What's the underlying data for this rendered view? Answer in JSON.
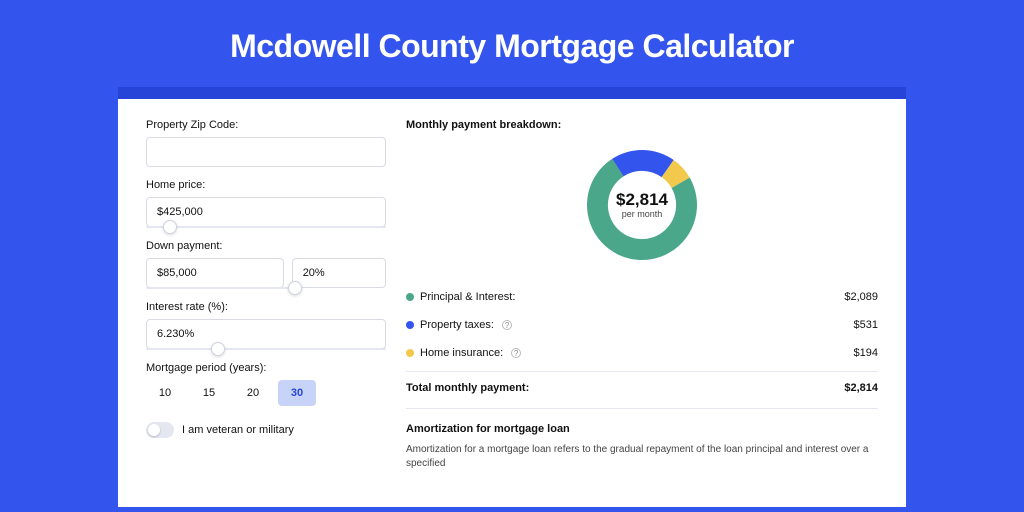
{
  "title": "Mcdowell County Mortgage Calculator",
  "form": {
    "zip_label": "Property Zip Code:",
    "zip_value": "",
    "home_price_label": "Home price:",
    "home_price_value": "$425,000",
    "home_price_slider_pct": 10,
    "down_payment_label": "Down payment:",
    "down_payment_value": "$85,000",
    "down_payment_pct": "20%",
    "down_payment_slider_pct": 20,
    "interest_label": "Interest rate (%):",
    "interest_value": "6.230%",
    "interest_slider_pct": 30,
    "period_label": "Mortgage period (years):",
    "periods": [
      "10",
      "15",
      "20",
      "30"
    ],
    "period_selected_index": 3,
    "veteran_label": "I am veteran or military"
  },
  "breakdown": {
    "title": "Monthly payment breakdown:",
    "center_value": "$2,814",
    "center_sub": "per month",
    "items": [
      {
        "label": "Principal & Interest:",
        "value": "$2,089",
        "color": "#4aa789",
        "has_info": false
      },
      {
        "label": "Property taxes:",
        "value": "$531",
        "color": "#3355ee",
        "has_info": true
      },
      {
        "label": "Home insurance:",
        "value": "$194",
        "color": "#f2c94c",
        "has_info": true
      }
    ],
    "total_label": "Total monthly payment:",
    "total_value": "$2,814"
  },
  "chart_data": {
    "type": "pie",
    "title": "Monthly payment breakdown",
    "categories": [
      "Principal & Interest",
      "Property taxes",
      "Home insurance"
    ],
    "values": [
      2089,
      531,
      194
    ],
    "colors": [
      "#4aa789",
      "#3355ee",
      "#f2c94c"
    ],
    "total": 2814,
    "donut_inner_ratio": 0.62
  },
  "amort": {
    "title": "Amortization for mortgage loan",
    "text": "Amortization for a mortgage loan refers to the gradual repayment of the loan principal and interest over a specified"
  }
}
